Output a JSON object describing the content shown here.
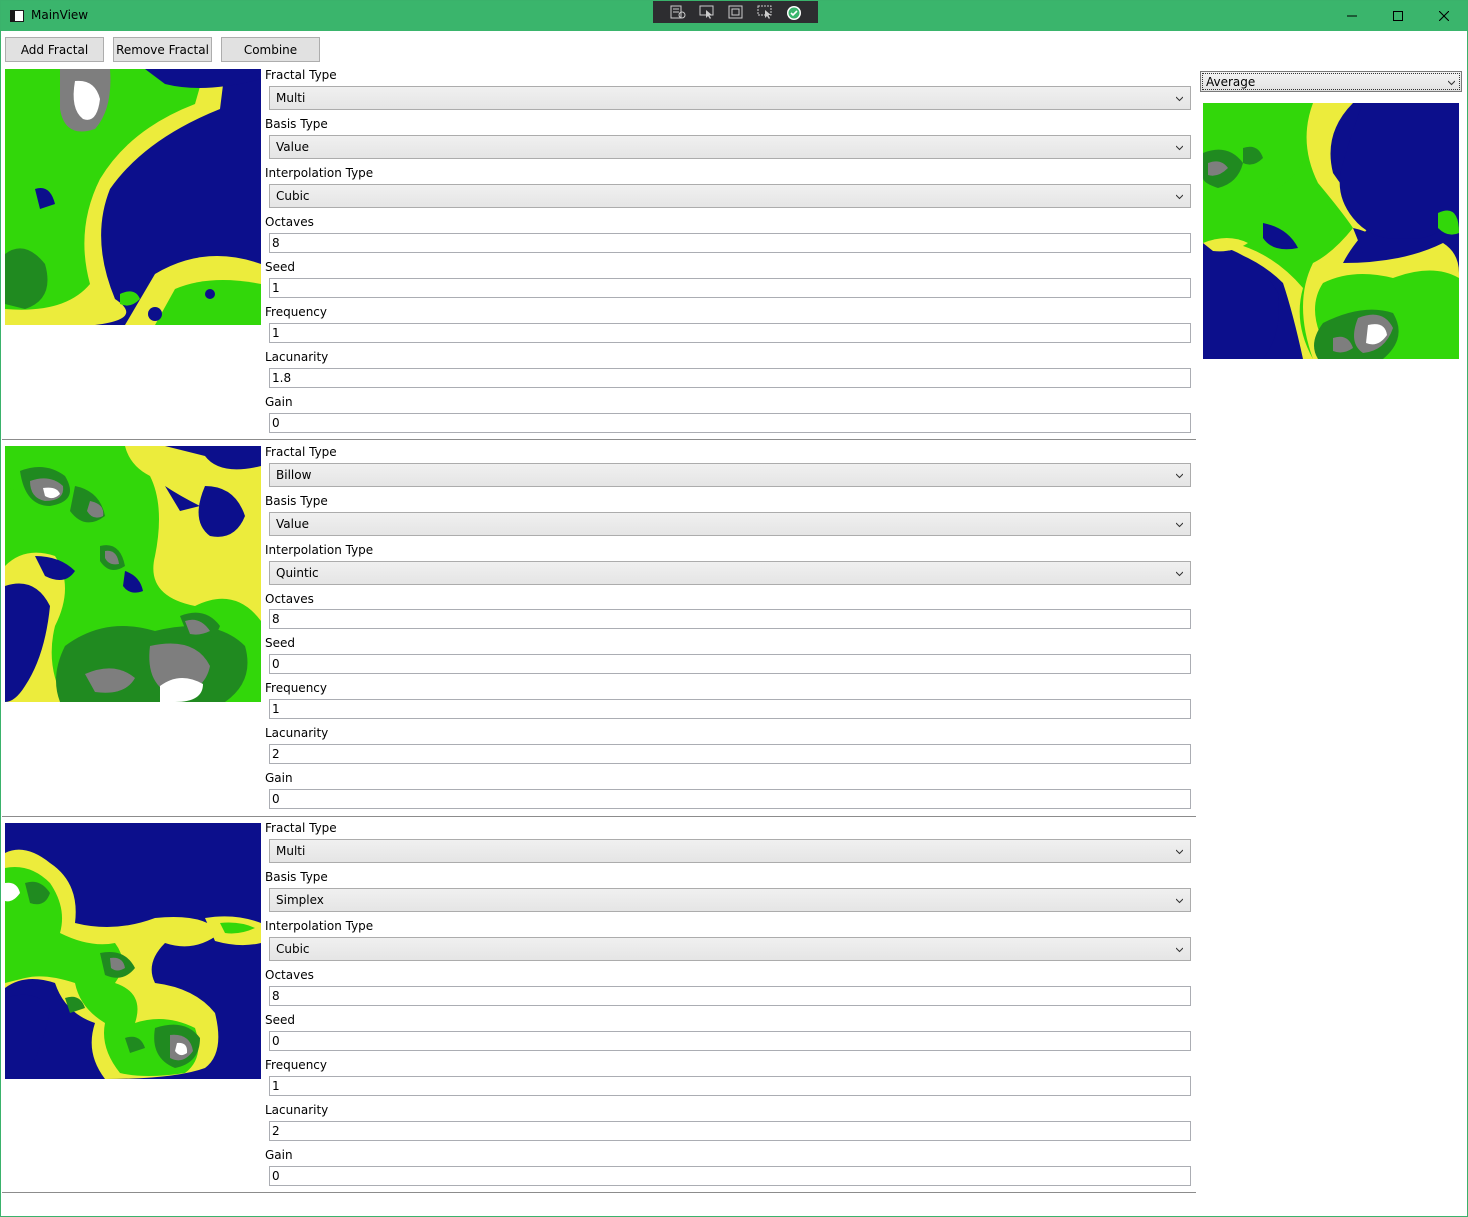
{
  "window": {
    "title": "MainView",
    "titlebar_color": "#3ab56c",
    "icons": {
      "app": "window-icon",
      "dev": [
        "live-visual-tree-icon",
        "select-element-icon",
        "display-layout-adorners-icon",
        "track-focused-element-icon",
        "binding-check-icon"
      ],
      "controls": [
        "minimize-icon",
        "maximize-icon",
        "close-icon"
      ]
    }
  },
  "toolbar": {
    "add_label": "Add Fractal",
    "remove_label": "Remove Fractal",
    "combine_label": "Combine"
  },
  "labels": {
    "fractal_type": "Fractal Type",
    "basis_type": "Basis Type",
    "interpolation_type": "Interpolation Type",
    "octaves": "Octaves",
    "seed": "Seed",
    "frequency": "Frequency",
    "lacunarity": "Lacunarity",
    "gain": "Gain"
  },
  "fractals": [
    {
      "fractal_type": "Multi",
      "basis_type": "Value",
      "interpolation_type": "Cubic",
      "octaves": "8",
      "seed": "1",
      "frequency": "1",
      "lacunarity": "1.8",
      "gain": "0"
    },
    {
      "fractal_type": "Billow",
      "basis_type": "Value",
      "interpolation_type": "Quintic",
      "octaves": "8",
      "seed": "0",
      "frequency": "1",
      "lacunarity": "2",
      "gain": "0"
    },
    {
      "fractal_type": "Multi",
      "basis_type": "Simplex",
      "interpolation_type": "Cubic",
      "octaves": "8",
      "seed": "0",
      "frequency": "1",
      "lacunarity": "2",
      "gain": "0"
    }
  ],
  "combine": {
    "mode": "Average"
  },
  "terrain_colors": {
    "water": "#0c0f8c",
    "sand": "#ecec3c",
    "grass": "#32d70a",
    "forest": "#208a20",
    "rock": "#7e7e7e",
    "snow": "#ffffff"
  }
}
